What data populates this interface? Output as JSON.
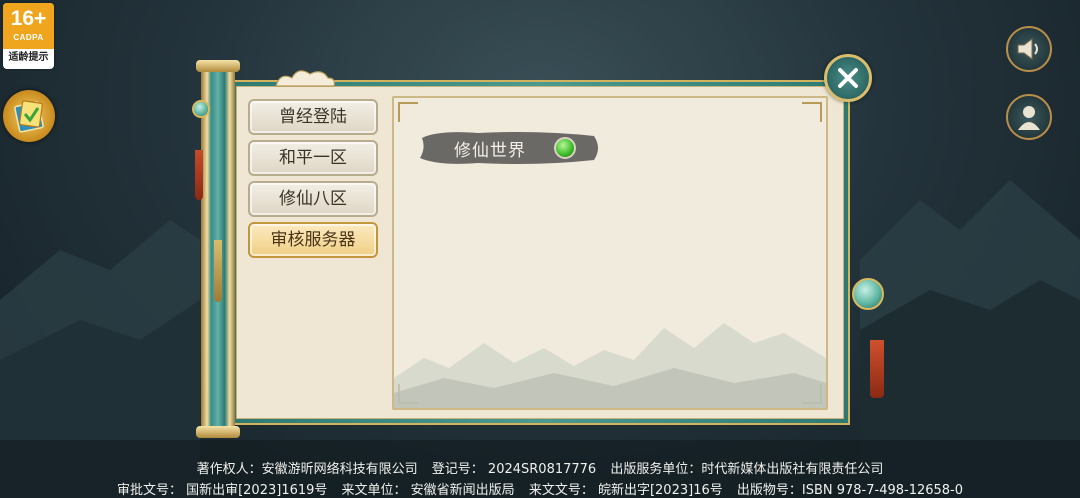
{
  "age_rating": {
    "number": "16+",
    "org": "CADPA",
    "tip": "适龄提示"
  },
  "server_tabs": [
    {
      "label": "曾经登陆",
      "active": false
    },
    {
      "label": "和平一区",
      "active": false
    },
    {
      "label": "修仙八区",
      "active": false
    },
    {
      "label": "审核服务器",
      "active": true
    }
  ],
  "server_list": [
    {
      "name": "修仙世界",
      "status": "online",
      "status_color": "#42c02c"
    }
  ],
  "icons": {
    "notice": "announcement-icon",
    "speaker": "speaker-icon",
    "user": "user-icon",
    "close": "close-icon"
  },
  "footer": {
    "line1": [
      "著作权人：安徽游昕网络科技有限公司",
      "登记号：  2024SR0817776",
      "出版服务单位：时代新媒体出版社有限责任公司"
    ],
    "line2": [
      "审批文号：  国新出审[2023]1619号",
      "来文单位：  安徽省新闻出版局",
      "来文文号：  皖新出字[2023]16号",
      "出版物号：ISBN 978-7-498-12658-0"
    ]
  },
  "colors": {
    "accent_gold": "#d2b360",
    "jade": "#3c8c86",
    "paper": "#efe7d3"
  }
}
